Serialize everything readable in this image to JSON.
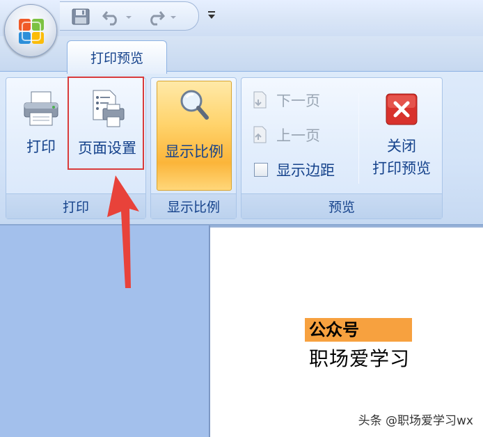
{
  "tabs": {
    "active": "打印预览"
  },
  "ribbon": {
    "groups": {
      "print": {
        "label": "打印",
        "buttons": {
          "print": "打印",
          "page_setup": "页面设置"
        }
      },
      "zoom": {
        "label": "显示比例",
        "buttons": {
          "zoom": "显示比例"
        }
      },
      "preview": {
        "label": "预览",
        "buttons": {
          "next_page": "下一页",
          "prev_page": "上一页",
          "show_margins": "显示边距",
          "close_line1": "关闭",
          "close_line2": "打印预览"
        }
      }
    }
  },
  "document": {
    "highlight_text": "公众号",
    "body_text": "职场爱学习"
  },
  "watermark": "头条 @职场爱学习wx",
  "colors": {
    "accent_red": "#d93b3b",
    "highlight_orange": "#f7a13f",
    "ribbon_text": "#15428b"
  },
  "icons": {
    "office": "office-logo-icon",
    "save": "save-icon",
    "undo": "undo-icon",
    "redo": "redo-icon",
    "print": "printer-icon",
    "page_setup": "page-setup-icon",
    "zoom": "magnifier-icon",
    "next": "next-page-icon",
    "prev": "prev-page-icon",
    "close": "close-x-icon"
  },
  "state": {
    "show_margins_checked": false,
    "highlight_box_around": "page_setup"
  }
}
